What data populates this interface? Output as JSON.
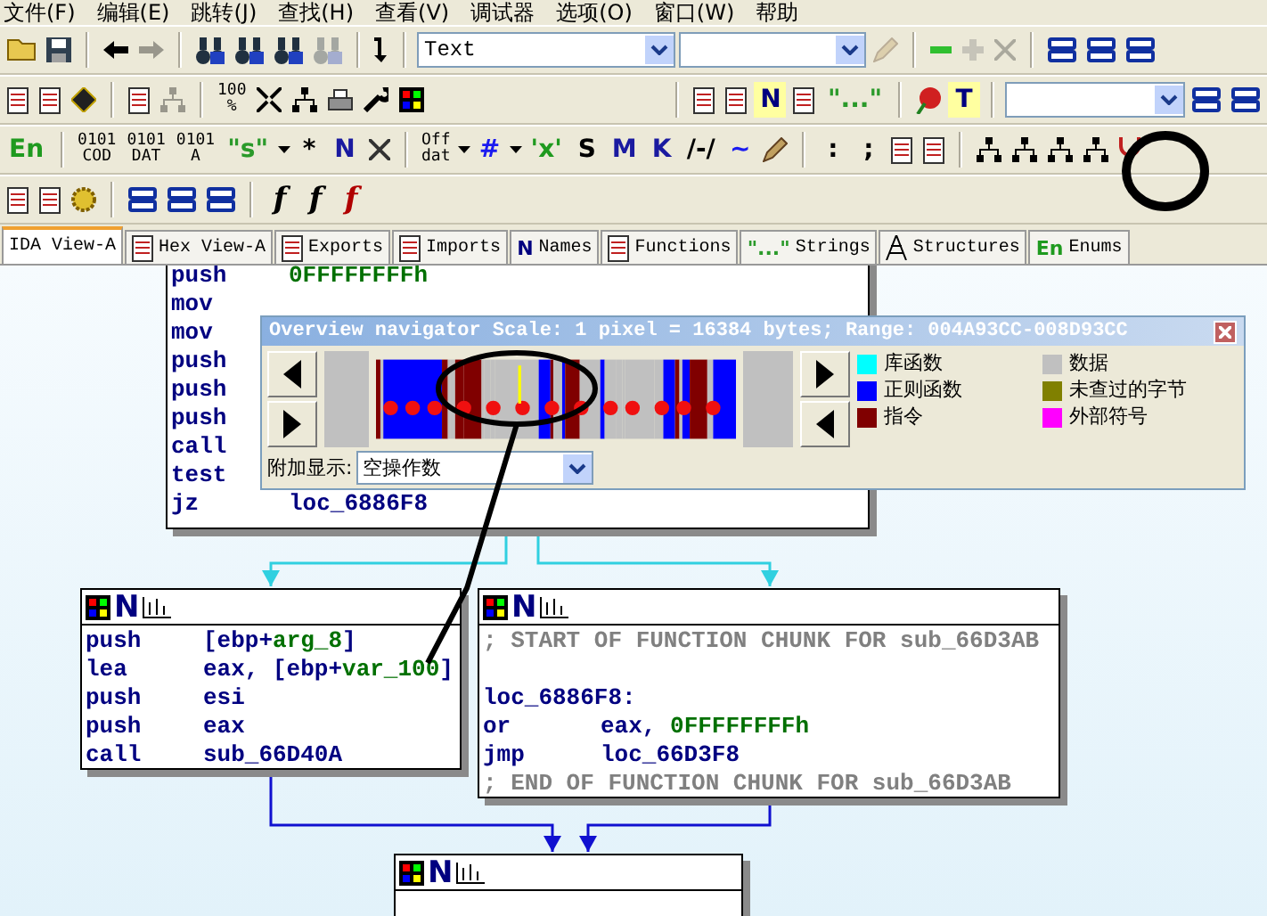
{
  "menu": [
    "文件(F)",
    "编辑(E)",
    "跳转(J)",
    "查找(H)",
    "查看(V)",
    "调试器",
    "选项(O)",
    "窗口(W)",
    "帮助"
  ],
  "toolbars": [
    [
      {
        "kind": "open"
      },
      {
        "kind": "save"
      },
      {
        "kind": "sep"
      },
      {
        "kind": "back"
      },
      {
        "kind": "forward",
        "disabled": true
      },
      {
        "kind": "sep"
      },
      {
        "kind": "binoculars"
      },
      {
        "kind": "binoculars"
      },
      {
        "kind": "binoculars"
      },
      {
        "kind": "binoculars",
        "disabled": true
      },
      {
        "kind": "sep"
      },
      {
        "kind": "jump"
      },
      {
        "kind": "sep"
      },
      {
        "kind": "combo",
        "value": "Text"
      },
      {
        "kind": "combo"
      },
      {
        "kind": "pen",
        "disabled": true
      },
      {
        "kind": "sep"
      },
      {
        "kind": "minus"
      },
      {
        "kind": "plus",
        "disabled": true
      },
      {
        "kind": "cross",
        "disabled": true
      },
      {
        "kind": "sep"
      },
      {
        "kind": "windows"
      },
      {
        "kind": "windows"
      },
      {
        "kind": "windows"
      }
    ],
    [
      {
        "kind": "doc"
      },
      {
        "kind": "doc"
      },
      {
        "kind": "diamond"
      },
      {
        "kind": "sep"
      },
      {
        "kind": "doc"
      },
      {
        "kind": "graph",
        "disabled": true
      },
      {
        "kind": "sep"
      },
      {
        "kind": "stack",
        "lines": [
          "100",
          "%"
        ]
      },
      {
        "kind": "shrink"
      },
      {
        "kind": "graph"
      },
      {
        "kind": "printer"
      },
      {
        "kind": "wrench"
      },
      {
        "kind": "palette"
      },
      {
        "kind": "gap"
      },
      {
        "kind": "sep"
      },
      {
        "kind": "doc"
      },
      {
        "kind": "doc"
      },
      {
        "kind": "glyph",
        "text": "N",
        "color": "#000080",
        "boxed": true
      },
      {
        "kind": "doc"
      },
      {
        "kind": "glyph",
        "text": "\"...\"",
        "color": "#2a9a2a"
      },
      {
        "kind": "sep"
      },
      {
        "kind": "flag"
      },
      {
        "kind": "glyph",
        "text": "T",
        "color": "#000080",
        "boxed": true
      },
      {
        "kind": "sep"
      },
      {
        "kind": "combo"
      },
      {
        "kind": "windows"
      },
      {
        "kind": "windows"
      }
    ],
    [
      {
        "kind": "glyph",
        "text": "En",
        "color": "#1f9a1f"
      },
      {
        "kind": "sep"
      },
      {
        "kind": "stack",
        "lines": [
          "0101",
          "COD"
        ]
      },
      {
        "kind": "stack",
        "lines": [
          "0101",
          "DAT"
        ]
      },
      {
        "kind": "stack",
        "lines": [
          "0101",
          "A"
        ]
      },
      {
        "kind": "glyph",
        "text": "\"s\"",
        "color": "#2a9a2a"
      },
      {
        "kind": "caret"
      },
      {
        "kind": "glyph",
        "text": "*",
        "color": "#000000"
      },
      {
        "kind": "glyph",
        "text": "N",
        "color": "#1a1aa0"
      },
      {
        "kind": "cross"
      },
      {
        "kind": "sep"
      },
      {
        "kind": "stack",
        "lines": [
          "Off",
          "dat"
        ]
      },
      {
        "kind": "caret"
      },
      {
        "kind": "glyph",
        "text": "#",
        "color": "#1a1af0"
      },
      {
        "kind": "caret"
      },
      {
        "kind": "glyph",
        "text": "'x'",
        "color": "#1f9a1f"
      },
      {
        "kind": "glyph",
        "text": "S",
        "color": "#000000"
      },
      {
        "kind": "glyph",
        "text": "M",
        "color": "#1a1aa0"
      },
      {
        "kind": "glyph",
        "text": "K",
        "color": "#1a1aa0"
      },
      {
        "kind": "glyph",
        "text": "/-/",
        "color": "#000000"
      },
      {
        "kind": "glyph",
        "text": "~",
        "color": "#1a1af0"
      },
      {
        "kind": "pen"
      },
      {
        "kind": "sep"
      },
      {
        "kind": "glyph",
        "text": ":",
        "color": "#000000"
      },
      {
        "kind": "glyph",
        "text": ";",
        "color": "#000000"
      },
      {
        "kind": "doc"
      },
      {
        "kind": "doc"
      },
      {
        "kind": "sep"
      },
      {
        "kind": "graph"
      },
      {
        "kind": "graph"
      },
      {
        "kind": "graph"
      },
      {
        "kind": "graph"
      },
      {
        "kind": "fork"
      }
    ],
    [
      {
        "kind": "doc"
      },
      {
        "kind": "doc"
      },
      {
        "kind": "gear"
      },
      {
        "kind": "sep"
      },
      {
        "kind": "windows"
      },
      {
        "kind": "windows"
      },
      {
        "kind": "windows"
      },
      {
        "kind": "sep"
      },
      {
        "kind": "glyph",
        "text": "f",
        "color": "#000000",
        "italic": true
      },
      {
        "kind": "glyph",
        "text": "f",
        "color": "#000000",
        "italic": true
      },
      {
        "kind": "glyph",
        "text": "f",
        "color": "#b00000",
        "italic": true
      }
    ]
  ],
  "tabs": [
    {
      "label": "IDA View-A",
      "selected": true
    },
    {
      "label": "Hex View-A",
      "selected": false
    },
    {
      "label": "Exports",
      "selected": false
    },
    {
      "label": "Imports",
      "selected": false
    },
    {
      "label": "Names",
      "selected": false,
      "glyph": "N",
      "color": "#000080"
    },
    {
      "label": "Functions",
      "selected": false
    },
    {
      "label": "Strings",
      "selected": false,
      "glyph": "\"...\"",
      "color": "#2a9a2a"
    },
    {
      "label": "Structures",
      "selected": false
    },
    {
      "label": "Enums",
      "selected": false,
      "glyph": "En",
      "color": "#1f9a1f"
    }
  ],
  "graph": {
    "nodes": [
      {
        "header": false,
        "lines": [
          {
            "mnemonic": "push",
            "operand": [
              {
                "text": "0FFFFFFFFh",
                "kind": "number"
              }
            ]
          },
          {
            "mnemonic": "mov"
          },
          {
            "mnemonic": "mov"
          },
          {
            "mnemonic": "push"
          },
          {
            "mnemonic": "push"
          },
          {
            "mnemonic": "push"
          },
          {
            "mnemonic": "call"
          },
          {
            "mnemonic": "test"
          },
          {
            "mnemonic": "jz",
            "operand": [
              {
                "text": "loc_6886F8",
                "kind": "name"
              }
            ]
          }
        ]
      },
      {
        "header": true,
        "glyph": "N",
        "lines": [
          {
            "mnemonic": "push",
            "operand": [
              {
                "text": "[ebp+",
                "kind": "name"
              },
              {
                "text": "arg_8",
                "kind": "number"
              },
              {
                "text": "]",
                "kind": "name"
              }
            ]
          },
          {
            "mnemonic": "lea",
            "operand": [
              {
                "text": "eax, [ebp+",
                "kind": "name"
              },
              {
                "text": "var_100",
                "kind": "number"
              },
              {
                "text": "]",
                "kind": "name"
              }
            ]
          },
          {
            "mnemonic": "push",
            "operand": [
              {
                "text": "esi",
                "kind": "name"
              }
            ]
          },
          {
            "mnemonic": "push",
            "operand": [
              {
                "text": "eax",
                "kind": "name"
              }
            ]
          },
          {
            "mnemonic": "call",
            "operand": [
              {
                "text": "sub_66D40A",
                "kind": "name"
              }
            ]
          }
        ]
      },
      {
        "header": true,
        "glyph": "N",
        "lines": [
          {
            "comment": "; START OF FUNCTION CHUNK FOR sub_66D3AB"
          },
          {
            "label": "loc_6886F8:"
          },
          {
            "mnemonic": "or",
            "operand": [
              {
                "text": "eax, ",
                "kind": "name"
              },
              {
                "text": "0FFFFFFFFh",
                "kind": "number"
              }
            ]
          },
          {
            "mnemonic": "jmp",
            "operand": [
              {
                "text": "loc_66D3F8",
                "kind": "name"
              }
            ]
          },
          {
            "comment": "; END OF FUNCTION CHUNK FOR sub_66D3AB"
          }
        ]
      },
      {
        "header": true,
        "glyph": "N"
      }
    ]
  },
  "navigator": {
    "title": "Overview navigator Scale: 1 pixel = 16384 bytes; Range: 004A93CC-008D93CC",
    "legend": [
      {
        "label": "库函数",
        "color": "#00ffff"
      },
      {
        "label": "数据",
        "color": "#c0c0c0"
      },
      {
        "label": "正则函数",
        "color": "#0000ff"
      },
      {
        "label": "未查过的字节",
        "color": "#808000"
      },
      {
        "label": "指令",
        "color": "#800000"
      },
      {
        "label": "外部符号",
        "color": "#ff00ff"
      }
    ],
    "extra_label": "附加显示:",
    "extra_value": "空操作数"
  }
}
